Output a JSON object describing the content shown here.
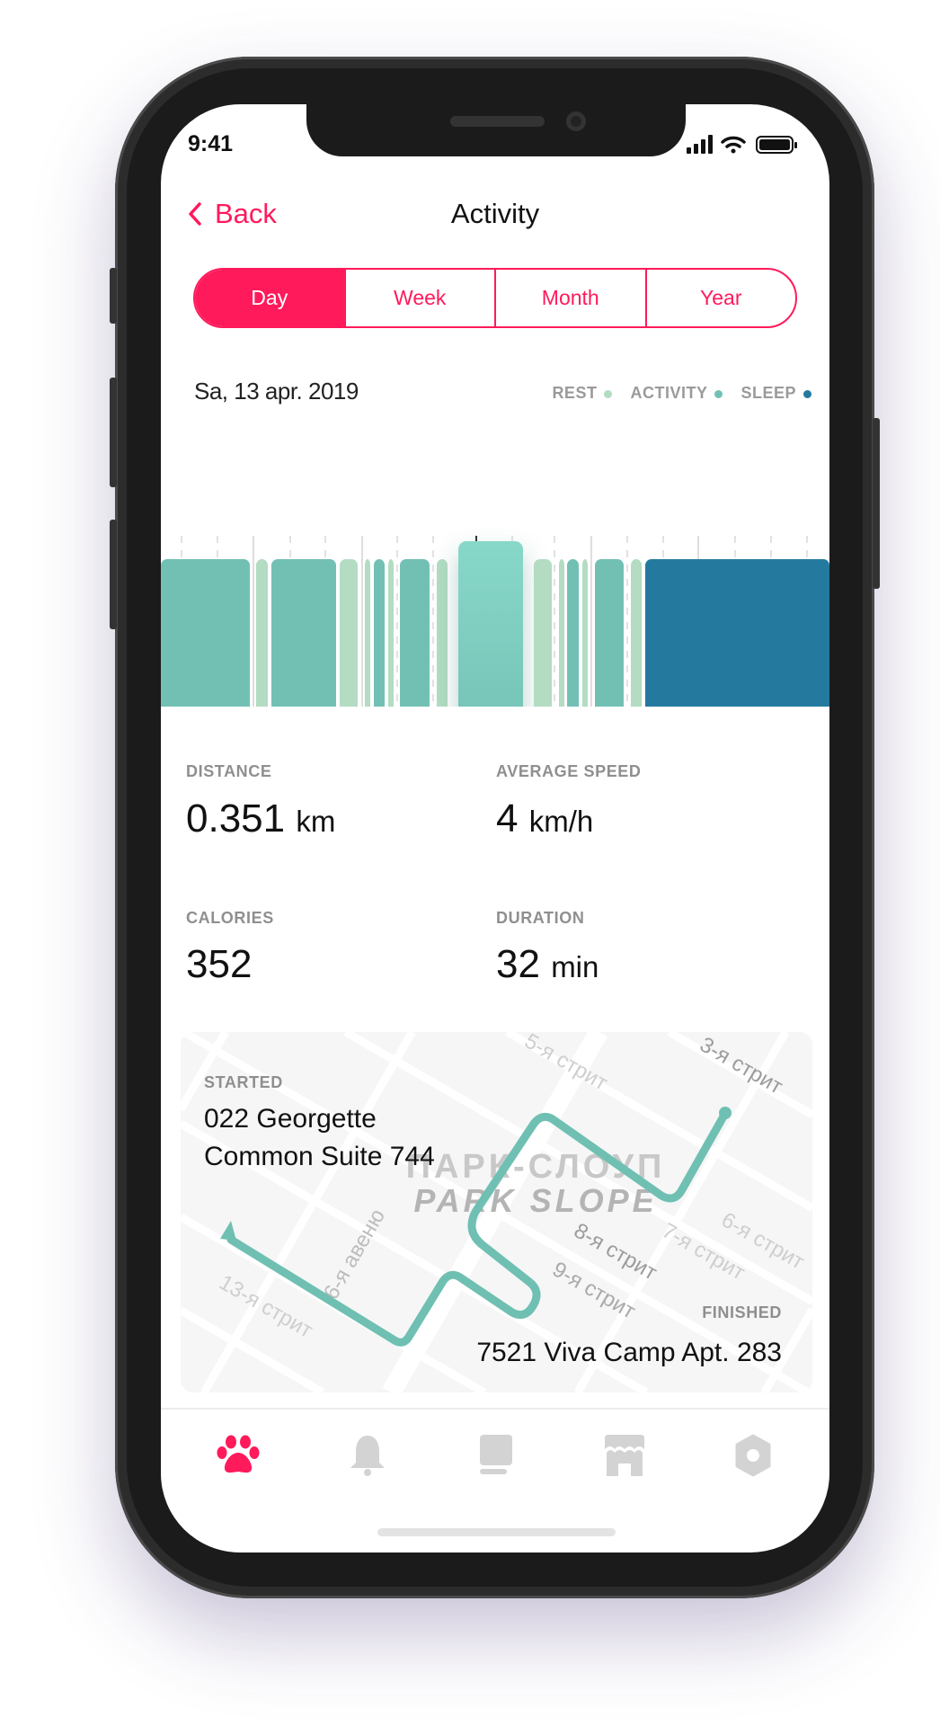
{
  "status_bar": {
    "time": "9:41"
  },
  "header": {
    "back_label": "Back",
    "title": "Activity"
  },
  "segments": [
    {
      "label": "Day",
      "active": true
    },
    {
      "label": "Week",
      "active": false
    },
    {
      "label": "Month",
      "active": false
    },
    {
      "label": "Year",
      "active": false
    }
  ],
  "colors": {
    "accent": "#ff1a5b",
    "rest": "#b3dcc2",
    "activity": "#72c0b4",
    "sleep": "#237a9e",
    "selected": "#86d6c8",
    "inactive_icon": "#d3d3d3"
  },
  "timeline": {
    "date": "Sa, 13 apr. 2019",
    "legend": [
      {
        "label": "REST",
        "type": "rest"
      },
      {
        "label": "ACTIVITY",
        "type": "activity"
      },
      {
        "label": "SLEEP",
        "type": "sleep"
      }
    ],
    "ticks": [
      "5:15",
      "16:30",
      "17:15",
      "17:45",
      "18:30",
      "19:15"
    ],
    "selected_tick": "17:45",
    "segments": [
      "activity",
      "rest",
      "activity",
      "rest",
      "rest",
      "activity",
      "rest",
      "activity",
      "rest",
      "selected",
      "rest",
      "rest",
      "activity",
      "rest",
      "activity",
      "rest",
      "sleep"
    ]
  },
  "stats": [
    {
      "label": "DISTANCE",
      "value": "0.351",
      "unit": "km"
    },
    {
      "label": "AVERAGE SPEED",
      "value": "4",
      "unit": "km/h"
    },
    {
      "label": "CALORIES",
      "value": "352",
      "unit": ""
    },
    {
      "label": "DURATION",
      "value": "32",
      "unit": "min"
    }
  ],
  "map": {
    "started_label": "STARTED",
    "started_line1": "022 Georgette",
    "started_line2": "Common Suite 744",
    "finished_label": "FINISHED",
    "finished_address": "7521 Viva Camp Apt. 283",
    "district_ru": "ПАРК-СЛОУП",
    "district_en": "PARK SLOPE",
    "streets": [
      "5-я стрит",
      "3-я стрит",
      "8-я стрит",
      "9-я стрит",
      "7-я стрит",
      "6-я стрит",
      "13-я стрит",
      "6-я авеню"
    ]
  },
  "tabbar": [
    {
      "icon": "paw-icon",
      "active": true
    },
    {
      "icon": "bell-icon",
      "active": false
    },
    {
      "icon": "tablet-icon",
      "active": false
    },
    {
      "icon": "store-icon",
      "active": false
    },
    {
      "icon": "hexagon-nut-icon",
      "active": false
    }
  ]
}
